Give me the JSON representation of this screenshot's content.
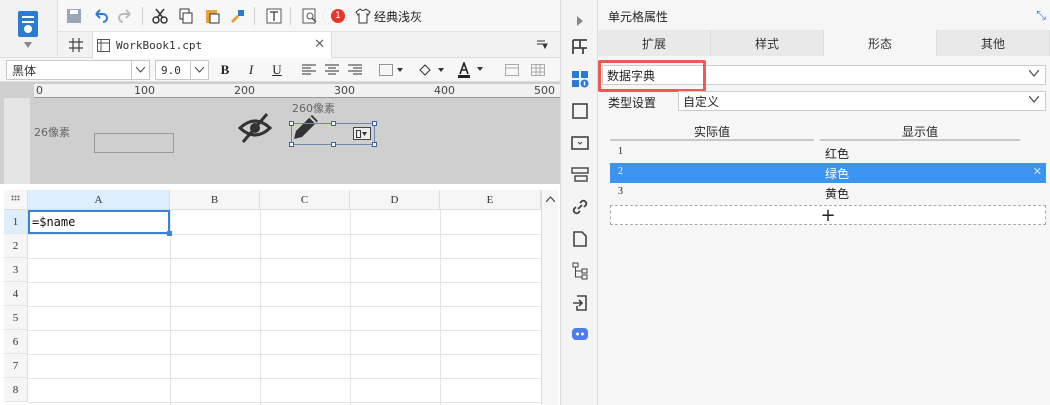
{
  "toolbar": {
    "notification_count": "1",
    "theme_label": "经典浅灰"
  },
  "tab": {
    "label": "WorkBook1.cpt"
  },
  "format": {
    "font_name": "黑体",
    "font_size": "9.0"
  },
  "design": {
    "ruler_marks": [
      "0",
      "100",
      "200",
      "300",
      "400",
      "500"
    ],
    "width_label": "260像素",
    "height_label": "26像素"
  },
  "grid": {
    "columns": [
      "A",
      "B",
      "C",
      "D",
      "E"
    ],
    "rows": [
      "1",
      "2",
      "3",
      "4",
      "5",
      "6",
      "7",
      "8"
    ],
    "cell_a1": "=$name"
  },
  "panel": {
    "title": "单元格属性",
    "tabs": [
      "扩展",
      "样式",
      "形态",
      "其他"
    ],
    "active_tab": "形态",
    "widget_type": "数据字典",
    "type_setting_label": "类型设置",
    "type_setting_value": "自定义",
    "dict_headers": [
      "实际值",
      "显示值"
    ],
    "dict_rows": [
      {
        "index": "1",
        "display": "红色"
      },
      {
        "index": "2",
        "display": "绿色"
      },
      {
        "index": "3",
        "display": "黄色"
      }
    ],
    "add_symbol": "+"
  },
  "colors": {
    "accent": "#3d94f0",
    "highlight_border": "#ee5a56",
    "selection": "#3b82d6"
  }
}
